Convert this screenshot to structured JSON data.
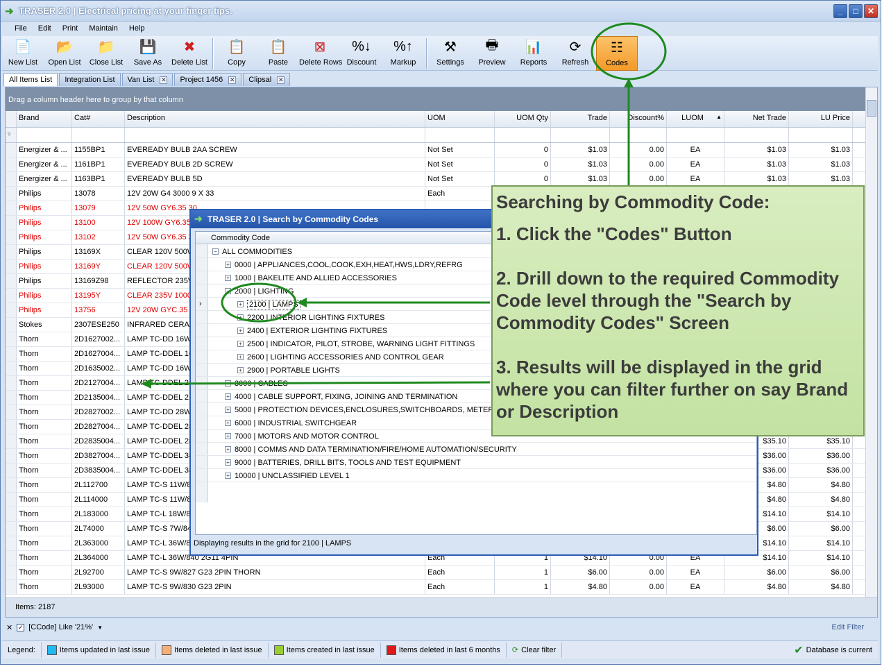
{
  "window": {
    "title": "TRASER 2.0 | Electrical pricing at your finger tips."
  },
  "menu": [
    "File",
    "Edit",
    "Print",
    "Maintain",
    "Help"
  ],
  "toolbar": {
    "buttons": [
      {
        "label": "New List",
        "icon": "new-list-icon"
      },
      {
        "label": "Open List",
        "icon": "folder-open-icon"
      },
      {
        "label": "Close List",
        "icon": "folder-close-icon"
      },
      {
        "label": "Save As",
        "icon": "save-icon"
      },
      {
        "label": "Delete List",
        "icon": "delete-icon"
      },
      {
        "label": "Copy",
        "icon": "copy-icon"
      },
      {
        "label": "Paste",
        "icon": "paste-icon"
      },
      {
        "label": "Delete Rows",
        "icon": "delete-rows-icon"
      },
      {
        "label": "Discount",
        "icon": "discount-icon"
      },
      {
        "label": "Markup",
        "icon": "markup-icon"
      },
      {
        "label": "Settings",
        "icon": "settings-icon"
      },
      {
        "label": "Preview",
        "icon": "preview-icon"
      },
      {
        "label": "Reports",
        "icon": "reports-icon"
      },
      {
        "label": "Refresh",
        "icon": "refresh-icon"
      },
      {
        "label": "Codes",
        "icon": "codes-icon"
      }
    ]
  },
  "tabs": [
    {
      "label": "All Items List",
      "closable": false
    },
    {
      "label": "Integration List",
      "closable": false
    },
    {
      "label": "Van List",
      "closable": true
    },
    {
      "label": "Project 1456",
      "closable": true
    },
    {
      "label": "Clipsal",
      "closable": true
    }
  ],
  "grid": {
    "group_hint": "Drag a column header here to group by that column",
    "columns": [
      "Brand",
      "Cat#",
      "Description",
      "UOM",
      "UOM Qty",
      "Trade",
      "Discount%",
      "LUOM",
      "Net Trade",
      "LU Price"
    ],
    "rows": [
      [
        "Energizer & ...",
        "1155BP1",
        "EVEREADY BULB 2AA SCREW",
        "Not Set",
        "0",
        "$1.03",
        "0.00",
        "EA",
        "$1.03",
        "$1.03",
        false
      ],
      [
        "Energizer & ...",
        "1161BP1",
        "EVEREADY BULB 2D SCREW",
        "Not Set",
        "0",
        "$1.03",
        "0.00",
        "EA",
        "$1.03",
        "$1.03",
        false
      ],
      [
        "Energizer & ...",
        "1163BP1",
        "EVEREADY BULB 5D",
        "Not Set",
        "0",
        "$1.03",
        "0.00",
        "EA",
        "$1.03",
        "$1.03",
        false
      ],
      [
        "Philips",
        "13078",
        "12V 20W G4 3000 9 X 33",
        "Each",
        "",
        "",
        "",
        "",
        "",
        "",
        false
      ],
      [
        "Philips",
        "13079",
        "12V 50W GY6.35 30",
        "",
        "",
        "",
        "",
        "",
        "",
        "",
        true
      ],
      [
        "Philips",
        "13100",
        "12V 100W GY6.35",
        "",
        "",
        "",
        "",
        "",
        "",
        "",
        true
      ],
      [
        "Philips",
        "13102",
        "12V 50W GY6.35 30",
        "",
        "",
        "",
        "",
        "",
        "",
        "",
        true
      ],
      [
        "Philips",
        "13169X",
        "CLEAR 120V 500W",
        "",
        "",
        "",
        "",
        "",
        "",
        "",
        false
      ],
      [
        "Philips",
        "13169Y",
        "CLEAR 120V 500W",
        "",
        "",
        "",
        "",
        "",
        "",
        "",
        true
      ],
      [
        "Philips",
        "13169Z98",
        "REFLECTOR 235V 5",
        "",
        "",
        "",
        "",
        "",
        "",
        "",
        false
      ],
      [
        "Philips",
        "13195Y",
        "CLEAR 235V 1000W",
        "",
        "",
        "",
        "",
        "",
        "",
        "",
        true
      ],
      [
        "Philips",
        "13756",
        "12V 20W GYC.35 3",
        "",
        "",
        "",
        "",
        "",
        "",
        "",
        true
      ],
      [
        "Stokes",
        "2307ESE250",
        "INFRARED CERAMI",
        "",
        "",
        "",
        "",
        "",
        "",
        "",
        false
      ],
      [
        "Thorn",
        "2D1627002...",
        "LAMP TC-DD 16W/8",
        "",
        "",
        "",
        "",
        "",
        "",
        "",
        false
      ],
      [
        "Thorn",
        "2D1627004...",
        "LAMP TC-DDEL 16V",
        "",
        "",
        "",
        "",
        "",
        "",
        "",
        false
      ],
      [
        "Thorn",
        "2D1635002...",
        "LAMP TC-DD 16W/8",
        "",
        "",
        "",
        "",
        "",
        "",
        "",
        false
      ],
      [
        "Thorn",
        "2D2127004...",
        "LAMP TC-DDEL 21V",
        "",
        "",
        "",
        "",
        "",
        "",
        "",
        false
      ],
      [
        "Thorn",
        "2D2135004...",
        "LAMP TC-DDEL 21V",
        "",
        "",
        "",
        "",
        "",
        "",
        "",
        false
      ],
      [
        "Thorn",
        "2D2827002...",
        "LAMP TC-DD 28W/8",
        "",
        "",
        "",
        "",
        "",
        "",
        "",
        false
      ],
      [
        "Thorn",
        "2D2827004...",
        "LAMP TC-DDEL 28V",
        "",
        "",
        "",
        "",
        "",
        "",
        "",
        false
      ],
      [
        "Thorn",
        "2D2835004...",
        "LAMP TC-DDEL 28V",
        "",
        "",
        "",
        "",
        "",
        "$35.10",
        "$35.10",
        false
      ],
      [
        "Thorn",
        "2D3827004...",
        "LAMP TC-DDEL 38V",
        "",
        "",
        "",
        "",
        "",
        "$36.00",
        "$36.00",
        false
      ],
      [
        "Thorn",
        "2D3835004...",
        "LAMP TC-DDEL 38V",
        "",
        "",
        "",
        "",
        "",
        "$36.00",
        "$36.00",
        false
      ],
      [
        "Thorn",
        "2L112700",
        "LAMP TC-S 11W/82",
        "",
        "",
        "",
        "",
        "",
        "$4.80",
        "$4.80",
        false
      ],
      [
        "Thorn",
        "2L114000",
        "LAMP TC-S 11W/84",
        "",
        "",
        "",
        "",
        "",
        "$4.80",
        "$4.80",
        false
      ],
      [
        "Thorn",
        "2L183000",
        "LAMP TC-L 18W/83",
        "",
        "",
        "",
        "",
        "",
        "$14.10",
        "$14.10",
        false
      ],
      [
        "Thorn",
        "2L74000",
        "LAMP TC-S 7W/840",
        "",
        "",
        "",
        "",
        "",
        "$6.00",
        "$6.00",
        false
      ],
      [
        "Thorn",
        "2L363000",
        "LAMP TC-L 36W/83",
        "",
        "",
        "",
        "",
        "",
        "$14.10",
        "$14.10",
        false
      ],
      [
        "Thorn",
        "2L364000",
        "LAMP TC-L 36W/840 2G11 4PIN",
        "Each",
        "1",
        "$14.10",
        "0.00",
        "EA",
        "$14.10",
        "$14.10",
        false
      ],
      [
        "Thorn",
        "2L92700",
        "LAMP TC-S 9W/827 G23 2PIN THORN",
        "Each",
        "1",
        "$6.00",
        "0.00",
        "EA",
        "$6.00",
        "$6.00",
        false
      ],
      [
        "Thorn",
        "2L93000",
        "LAMP TC-S 9W/830 G23 2PIN",
        "Each",
        "1",
        "$4.80",
        "0.00",
        "EA",
        "$4.80",
        "$4.80",
        false
      ]
    ],
    "items_count": "Items: 2187",
    "filter_text": "[CCode] Like '21%'",
    "edit_filter": "Edit Filter"
  },
  "legend": {
    "label": "Legend:",
    "items": [
      {
        "color": "#22b8f0",
        "label": "Items updated in last issue"
      },
      {
        "color": "#f4b07a",
        "label": "Items deleted in last issue"
      },
      {
        "color": "#9acd32",
        "label": "Items created in last issue"
      },
      {
        "color": "#e01818",
        "label": "Items deleted in last 6 months"
      }
    ],
    "clear_filter": "Clear filter",
    "db_status": "Database is current"
  },
  "dialog": {
    "title": "TRASER 2.0 | Search by Commodity Codes",
    "column": "Commodity Code",
    "nodes": [
      {
        "label": "ALL COMMODITIES",
        "level": 0,
        "sym": "−"
      },
      {
        "label": "0000 | APPLIANCES,COOL,COOK,EXH,HEAT,HWS,LDRY,REFRG",
        "level": 1,
        "sym": "+"
      },
      {
        "label": "1000 | BAKELITE AND ALLIED ACCESSORIES",
        "level": 1,
        "sym": "+"
      },
      {
        "label": "2000 | LIGHTING",
        "level": 1,
        "sym": "−"
      },
      {
        "label": "2100 | LAMPS",
        "level": 2,
        "sym": "+"
      },
      {
        "label": "2200 | INTERIOR LIGHTING FIXTURES",
        "level": 2,
        "sym": "+"
      },
      {
        "label": "2400 | EXTERIOR LIGHTING FIXTURES",
        "level": 2,
        "sym": "+"
      },
      {
        "label": "2500 | INDICATOR, PILOT, STROBE, WARNING LIGHT FITTINGS",
        "level": 2,
        "sym": "+"
      },
      {
        "label": "2600 | LIGHTING ACCESSORIES AND CONTROL GEAR",
        "level": 2,
        "sym": "+"
      },
      {
        "label": "2900 | PORTABLE LIGHTS",
        "level": 2,
        "sym": "+"
      },
      {
        "label": "3000 | CABLES",
        "level": 1,
        "sym": "+"
      },
      {
        "label": "4000 | CABLE SUPPORT, FIXING, JOINING AND TERMINATION",
        "level": 1,
        "sym": "+"
      },
      {
        "label": "5000 | PROTECTION DEVICES,ENCLOSURES,SWITCHBOARDS, METERBOXES",
        "level": 1,
        "sym": "+"
      },
      {
        "label": "6000 | INDUSTRIAL SWITCHGEAR",
        "level": 1,
        "sym": "+"
      },
      {
        "label": "7000 | MOTORS AND MOTOR CONTROL",
        "level": 1,
        "sym": "+"
      },
      {
        "label": "8000 | COMMS AND DATA TERMINATION/FIRE/HOME AUTOMATION/SECURITY",
        "level": 1,
        "sym": "+"
      },
      {
        "label": "9000 | BATTERIES, DRILL BITS, TOOLS AND TEST EQUIPMENT",
        "level": 1,
        "sym": "+"
      },
      {
        "label": "10000 | UNCLASSIFIED LEVEL 1",
        "level": 1,
        "sym": "+"
      }
    ],
    "status": "Displaying results in the grid for 2100 | LAMPS"
  },
  "callout": {
    "heading": "Searching by Commodity Code:",
    "step1": "1. Click the \"Codes\" Button",
    "step2": "2. Drill down to the required Commodity Code level through the \"Search by Commodity Codes\" Screen",
    "step3": "3. Results will be displayed in the grid where you can filter further on say Brand or Description",
    "color": "#c9e6a8"
  }
}
